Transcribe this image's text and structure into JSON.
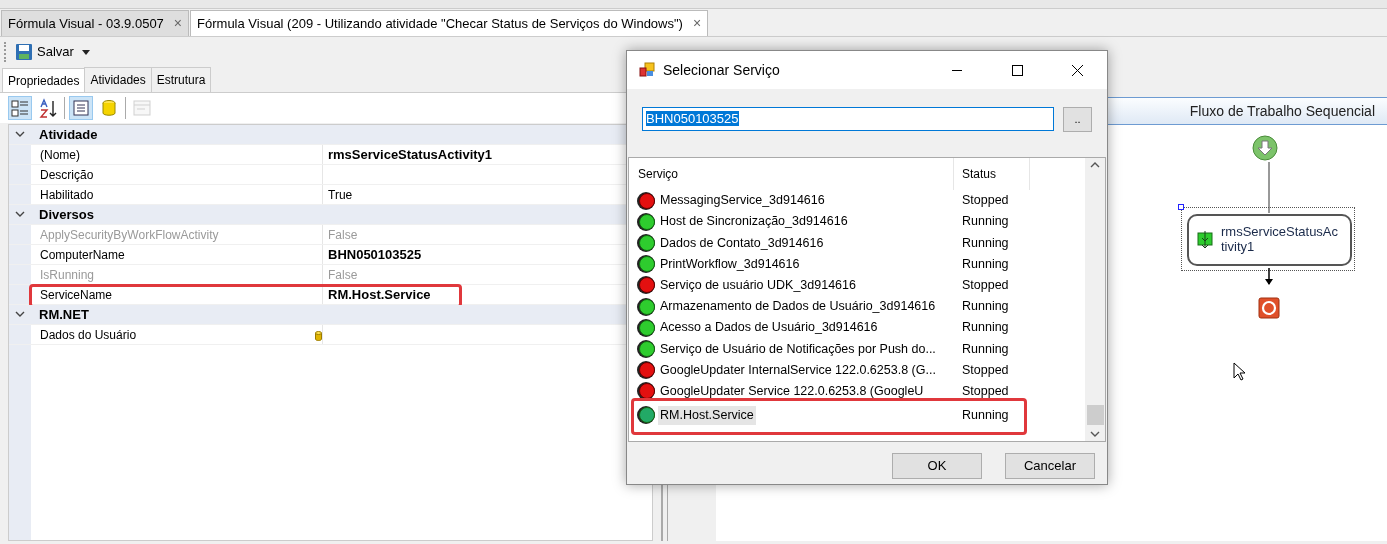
{
  "window_tabs": [
    {
      "label": "Fórmula Visual - 03.9.0507",
      "selected": false,
      "close": "×"
    },
    {
      "label": "Fórmula Visual (209 - Utilizando atividade \"Checar Status de Serviços do Windows\")",
      "selected": true,
      "close": "×"
    }
  ],
  "toolbar": {
    "save_label": "Salvar"
  },
  "panel_tabs": [
    {
      "label": "Propriedades",
      "selected": true
    },
    {
      "label": "Atividades",
      "selected": false
    },
    {
      "label": "Estrutura",
      "selected": false
    }
  ],
  "grid_toolbar": [
    {
      "kind": "categorized",
      "selected": true,
      "disabled": false
    },
    {
      "kind": "alphabetical",
      "selected": false,
      "disabled": false
    },
    {
      "kind": "properties",
      "selected": true,
      "disabled": false
    },
    {
      "kind": "data",
      "selected": false,
      "disabled": false
    },
    {
      "kind": "pages",
      "selected": false,
      "disabled": true
    }
  ],
  "property_grid": [
    {
      "category": "Atividade",
      "expanded": true,
      "properties": [
        {
          "name": "(Nome)",
          "value": "rmsServiceStatusActivity1",
          "kind": "text",
          "bold": true,
          "disabled": false,
          "highlighted": false
        },
        {
          "name": "Descrição",
          "kind": "text",
          "disabled": false,
          "highlighted": false
        },
        {
          "name": "Habilitado",
          "value": "True",
          "kind": "text",
          "bold": false,
          "disabled": false,
          "highlighted": false
        }
      ]
    },
    {
      "category": "Diversos",
      "expanded": true,
      "properties": [
        {
          "name": "ApplySecurityByWorkFlowActivity",
          "value": "False",
          "kind": "text",
          "bold": false,
          "disabled": true,
          "highlighted": false
        },
        {
          "name": "ComputerName",
          "value": "BHN050103525",
          "kind": "text",
          "bold": true,
          "disabled": false,
          "highlighted": false
        },
        {
          "name": "IsRunning",
          "value": "False",
          "kind": "text",
          "bold": false,
          "disabled": true,
          "highlighted": false
        },
        {
          "name": "ServiceName",
          "value": "RM.Host.Service",
          "kind": "text",
          "bold": true,
          "disabled": false,
          "highlighted": true
        }
      ]
    },
    {
      "category": "RM.NET",
      "expanded": true,
      "properties": [
        {
          "name": "Dados do Usuário",
          "kind": "data",
          "disabled": false,
          "highlighted": false
        }
      ]
    }
  ],
  "dialog": {
    "title": "Selecionar Serviço",
    "computer": "BHN050103525",
    "browse_label": "..",
    "columns": [
      "Serviço",
      "Status"
    ],
    "services": [
      {
        "name": "MessagingService_3d914616",
        "status": "Stopped",
        "running": false,
        "selected": false,
        "highlighted": false
      },
      {
        "name": "Host de Sincronização_3d914616",
        "status": "Running",
        "running": true,
        "selected": false,
        "highlighted": false
      },
      {
        "name": "Dados de Contato_3d914616",
        "status": "Running",
        "running": true,
        "selected": false,
        "highlighted": false
      },
      {
        "name": "PrintWorkflow_3d914616",
        "status": "Running",
        "running": true,
        "selected": false,
        "highlighted": false
      },
      {
        "name": "Serviço de usuário UDK_3d914616",
        "status": "Stopped",
        "running": false,
        "selected": false,
        "highlighted": false
      },
      {
        "name": "Armazenamento de Dados de Usuário_3d914616",
        "status": "Running",
        "running": true,
        "selected": false,
        "highlighted": false
      },
      {
        "name": "Acesso a Dados de Usuário_3d914616",
        "status": "Running",
        "running": true,
        "selected": false,
        "highlighted": false
      },
      {
        "name": "Serviço de Usuário de Notificações por Push do...",
        "status": "Running",
        "running": true,
        "selected": false,
        "highlighted": false
      },
      {
        "name": "GoogleUpdater InternalService 122.0.6253.8 (G...",
        "status": "Stopped",
        "running": false,
        "selected": false,
        "highlighted": false
      },
      {
        "name": "GoogleUpdater Service 122.0.6253.8 (GoogleU",
        "status": "Stopped",
        "running": false,
        "selected": false,
        "highlighted": false
      },
      {
        "name": "RM.Host.Service",
        "status": "Running",
        "running": true,
        "selected": true,
        "highlighted": true
      }
    ],
    "buttons": [
      "OK",
      "Cancelar"
    ]
  },
  "designer": {
    "header": "Fluxo de Trabalho Sequencial",
    "activity": "rmsServiceStatusActivity1",
    "activity_selected": true
  }
}
